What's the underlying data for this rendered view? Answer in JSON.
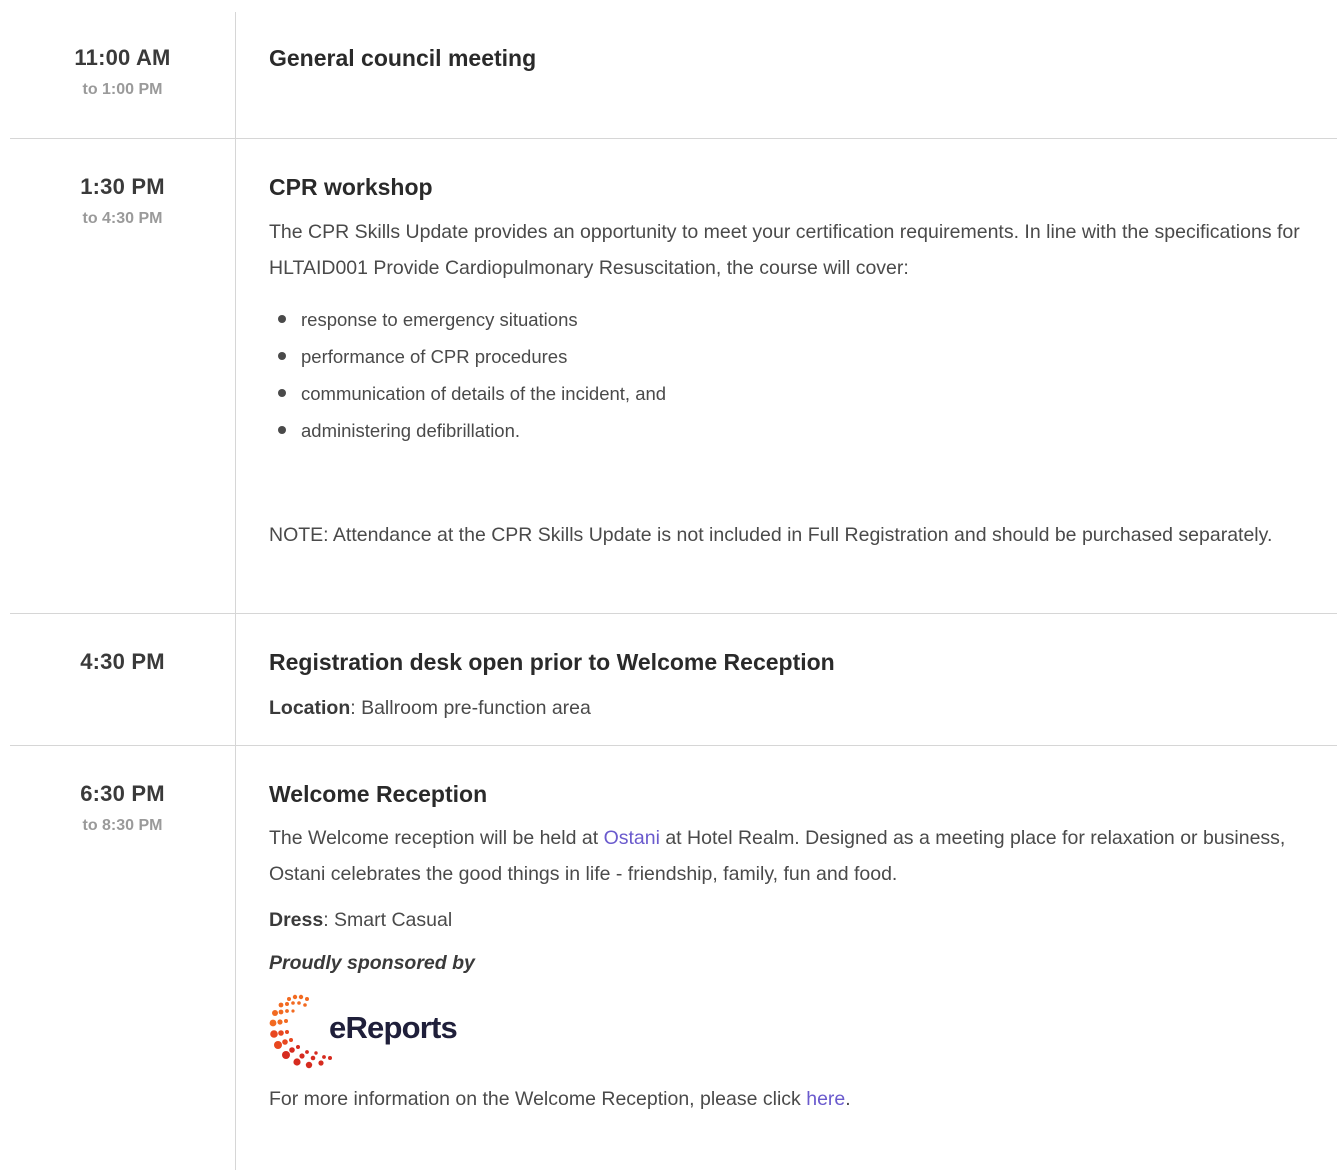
{
  "events": [
    {
      "start": "11:00 AM",
      "end": "to 1:00 PM",
      "title": "General council meeting"
    },
    {
      "start": "1:30 PM",
      "end": "to 4:30 PM",
      "title": "CPR workshop",
      "description": "The CPR Skills Update provides an opportunity to meet your certification requirements. In line with the specifications for HLTAID001 Provide Cardiopulmonary Resuscitation, the course will cover:",
      "bullets": [
        "response to emergency situations",
        "performance of CPR procedures",
        "communication of details of the incident, and",
        "administering defibrillation."
      ],
      "note": "NOTE: Attendance at the CPR Skills Update is not included in Full Registration and should be purchased separately."
    },
    {
      "start": "4:30 PM",
      "title": "Registration desk open prior to Welcome Reception",
      "location_label": "Location",
      "location_value": ": Ballroom pre-function area"
    },
    {
      "start": "6:30 PM",
      "end": "to 8:30 PM",
      "title": "Welcome Reception",
      "desc_before": "The Welcome reception will be held at ",
      "desc_link": "Ostani",
      "desc_after": " at Hotel Realm. Designed as a meeting place for relaxation or business, Ostani celebrates the good things in life - friendship, family, fun and food.",
      "dress_label": "Dress",
      "dress_value": ": Smart Casual",
      "sponsor_text": "Proudly sponsored by",
      "sponsor_logo": "eReports",
      "more_before": "For more information on the Welcome Reception, please click ",
      "more_link": "here",
      "more_after": "."
    }
  ],
  "colors": {
    "link": "#6a5acd",
    "divider": "#d6d6d6",
    "logo_orange": "#f26a21",
    "logo_red": "#d62b1f",
    "logo_text": "#1f1f3a"
  }
}
